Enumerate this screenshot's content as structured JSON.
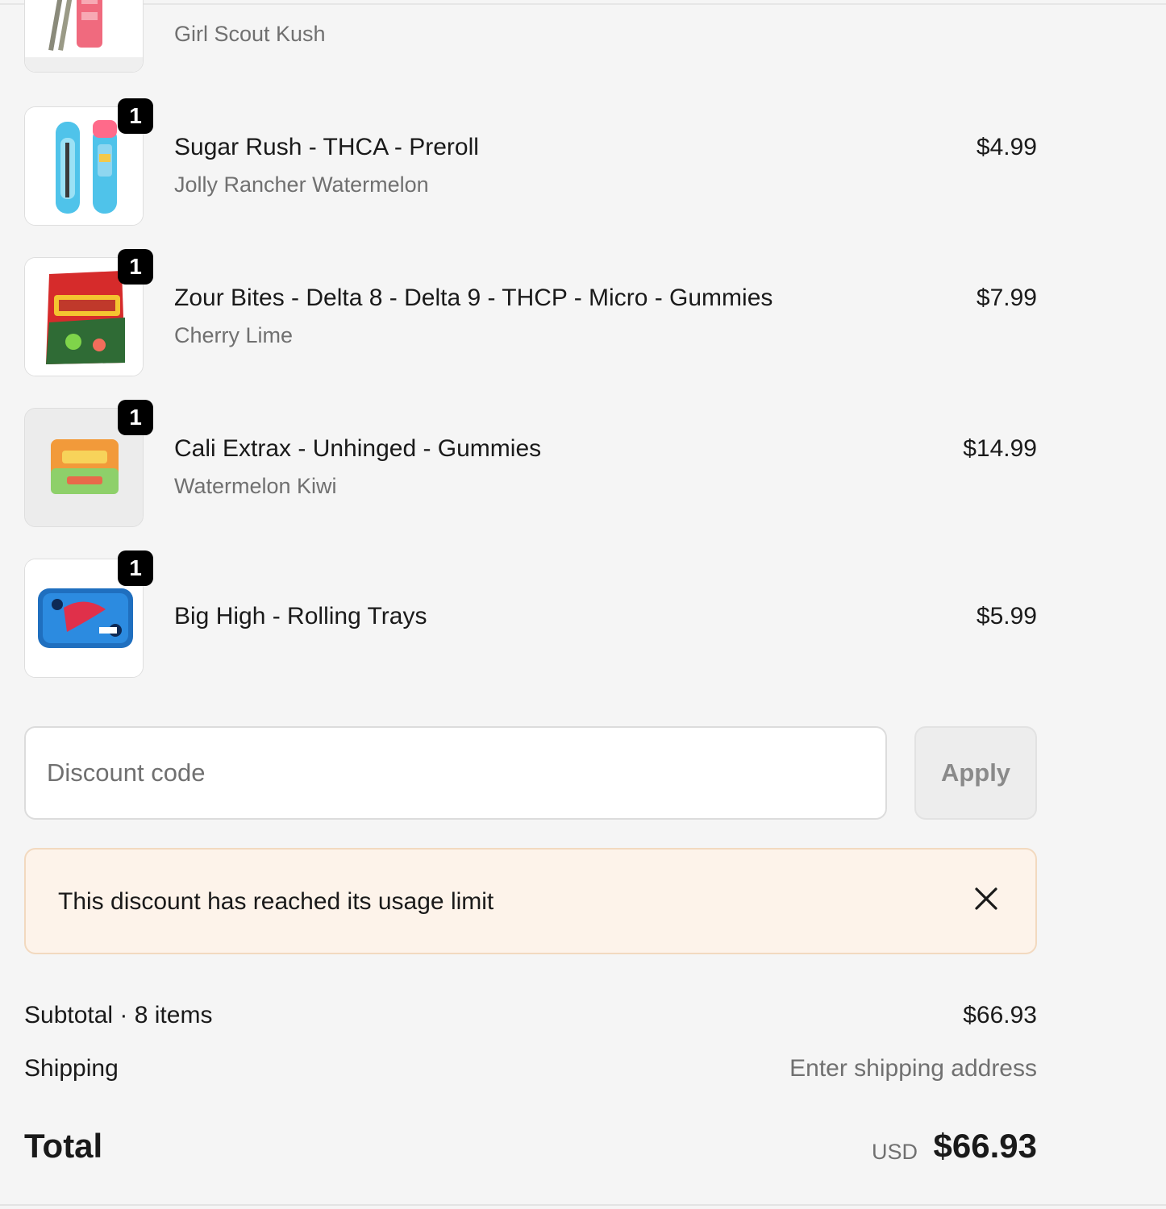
{
  "cart": {
    "items": [
      {
        "title": "",
        "variant": "Girl Scout Kush",
        "price": "",
        "quantity": ""
      },
      {
        "title": "Sugar Rush - THCA - Preroll",
        "variant": "Jolly Rancher Watermelon",
        "price": "$4.99",
        "quantity": "1"
      },
      {
        "title": "Zour Bites - Delta 8 - Delta 9 - THCP - Micro - Gummies",
        "variant": "Cherry Lime",
        "price": "$7.99",
        "quantity": "1"
      },
      {
        "title": "Cali Extrax - Unhinged - Gummies",
        "variant": "Watermelon Kiwi",
        "price": "$14.99",
        "quantity": "1"
      },
      {
        "title": "Big High - Rolling Trays",
        "variant": "",
        "price": "$5.99",
        "quantity": "1"
      }
    ]
  },
  "discount": {
    "placeholder": "Discount code",
    "value": "",
    "apply_label": "Apply",
    "error_message": "This discount has reached its usage limit"
  },
  "summary": {
    "subtotal_label": "Subtotal · 8 items",
    "subtotal_value": "$66.93",
    "shipping_label": "Shipping",
    "shipping_value": "Enter shipping address",
    "total_label": "Total",
    "currency": "USD",
    "total_value": "$66.93"
  },
  "icons": {
    "close": "close-icon"
  },
  "colors": {
    "page_background": "#f5f5f5",
    "badge": "#000000",
    "alert_background": "#fdf3ea",
    "alert_border": "#f2d9bf",
    "muted_text": "#707070"
  }
}
